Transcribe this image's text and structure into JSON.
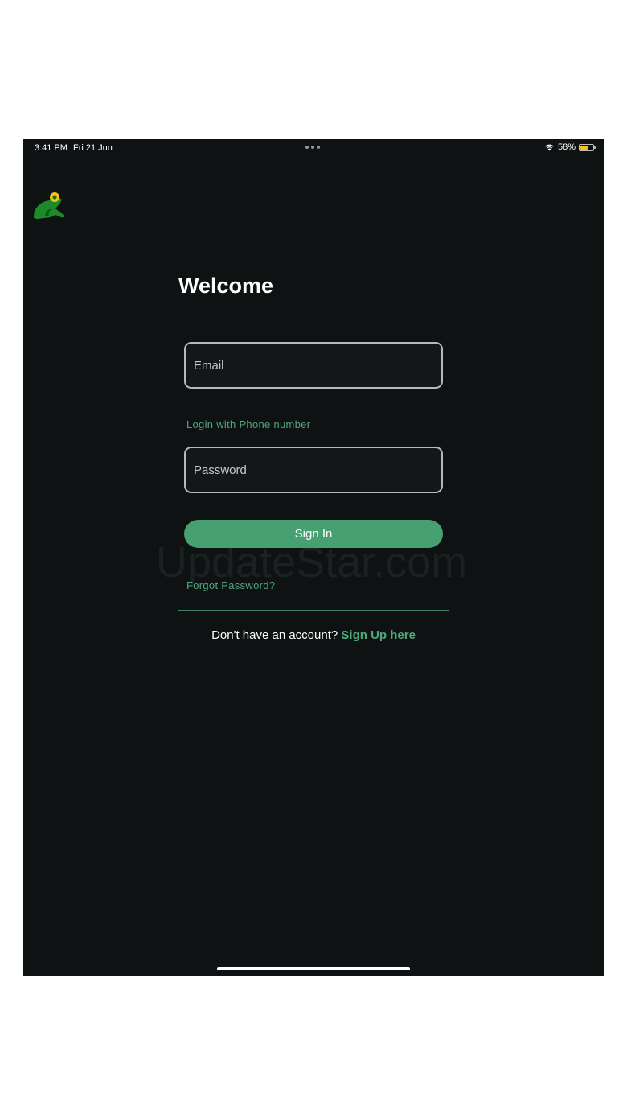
{
  "status_bar": {
    "time": "3:41 PM",
    "date": "Fri 21 Jun",
    "battery_percent_text": "58%",
    "battery_level": 0.58,
    "wifi_icon": "wifi-icon",
    "battery_icon": "battery-icon"
  },
  "logo": {
    "icon": "frog-logo-icon",
    "body_color": "#1d8a2a",
    "eye_color": "#f5c518"
  },
  "login": {
    "title": "Welcome",
    "email_placeholder": "Email",
    "phone_link": "Login with Phone number",
    "password_placeholder": "Password",
    "sign_in_label": "Sign In",
    "forgot_password": "Forgot Password?",
    "no_account_text": "Don't have an account?",
    "sign_up_link": "Sign Up here"
  },
  "watermark": "UpdateStar.com",
  "colors": {
    "background": "#0e1212",
    "accent": "#47a072",
    "link": "#4fa87c",
    "input_border": "#b5b9ba"
  }
}
